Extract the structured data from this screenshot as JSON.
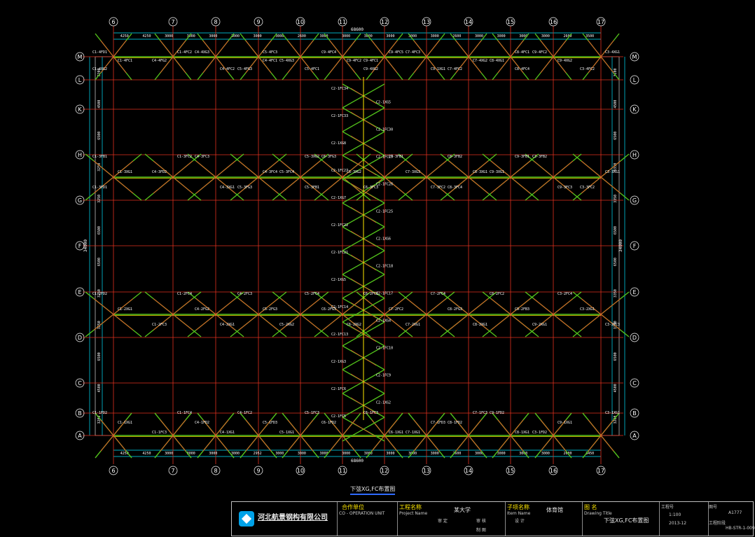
{
  "drawing": {
    "grid_cols": [
      "6",
      "7",
      "8",
      "9",
      "10",
      "11",
      "12",
      "13",
      "14",
      "15",
      "16",
      "17"
    ],
    "grid_rows": [
      "M",
      "L",
      "K",
      "H",
      "G",
      "F",
      "E",
      "D",
      "C",
      "B",
      "A"
    ],
    "overall_width": "68600",
    "overall_height": "34000",
    "top_spans": [
      "4250",
      "4250",
      "3000",
      "3000",
      "3000",
      "3000",
      "3000",
      "3000",
      "2600",
      "3000",
      "3000",
      "3000",
      "3000",
      "3000",
      "3000",
      "2600",
      "3000",
      "3000",
      "3000",
      "3000",
      "2600",
      "3500"
    ],
    "bottom_spans": [
      "4250",
      "4250",
      "3000",
      "3000",
      "3000",
      "3000",
      "2952",
      "3000",
      "3000",
      "3000",
      "3000",
      "3000",
      "3000",
      "3000",
      "3000",
      "2600",
      "3000",
      "3000",
      "3000",
      "3000",
      "2600",
      "3450"
    ],
    "left_spans": [
      "3200",
      "4500",
      "6500",
      "3250",
      "3250",
      "6500",
      "6500",
      "3250",
      "3250",
      "6500",
      "4500",
      "3200"
    ],
    "right_spans": [
      "3100",
      "4500",
      "6500",
      "3350",
      "3350",
      "6500",
      "6500",
      "3350",
      "3350",
      "6500",
      "4500",
      "3200"
    ],
    "brace_labels": {
      "row_M": [
        "C1-4FD1",
        "C1-4FC1",
        "C1-4XG2",
        "C1-4FC2",
        "C4-4FG2",
        "C4-4FC2",
        "C4-4XG3",
        "C4-4FC1",
        "C5-4FG3",
        "C5-4FC3",
        "C5-4XG3",
        "C5-4FC1",
        "C9-4FC4",
        "C9-4FC2",
        "C9-4XG2",
        "C9-4FC5",
        "C9-4FC1",
        "C9-1XG1",
        "C7-4FC3",
        "C7-4XG2",
        "C7-4FC2",
        "C8-4FC1",
        "C8-4XG1",
        "C8-4FC4",
        "C9-4FC2",
        "C9-4XG2",
        "C3-4FC2",
        "C3-4XG1"
      ],
      "row_H": [
        "C1-3FB1",
        "C1-3XG1",
        "C1-3FD1",
        "C1-3FC2",
        "C4-3FD2",
        "C4-3XG1",
        "C4-3FC3",
        "C4-3FC4",
        "C5-3FG3",
        "C5-3XG2",
        "C5-3FC4",
        "C5-3FB1",
        "C6-3FG3",
        "C6-3XG2",
        "C6-3FC3",
        "C7-3FB1",
        "C7-3XG3",
        "C7-3FC2",
        "C8-3FB2",
        "C8-3XG1",
        "C8-3FC4",
        "C9-3FB1",
        "C9-3XG1",
        "C9-3FC3",
        "C3-3FB2",
        "C3-3XG1",
        "C3-3FC2"
      ],
      "row_E": [
        "C1-2FD2",
        "C1-2XG1",
        "C1-2FC3",
        "C1-2FC4",
        "C4-2FG2",
        "C4-2XG1",
        "C4-2FC3",
        "C5-2FG3",
        "C5-2XG2",
        "C5-2FC4",
        "C6-2FG3",
        "C6-2XG2",
        "C6-2FC3",
        "C7-2FC2",
        "C7-2XG1",
        "C7-2FC4",
        "C8-2FG3",
        "C8-2XG1",
        "C8-2FC2",
        "C9-2FB3",
        "C9-2XG1",
        "C3-2FC4",
        "C3-2XG1",
        "C3-2FC3"
      ],
      "row_B": [
        "C1-1FD2",
        "C1-1XG1",
        "C1-1FC3",
        "C1-1FC4",
        "C4-1FD2",
        "C4-1XG1",
        "C4-1FC2",
        "C5-1FD3",
        "C5-1XG1",
        "C5-1FC3",
        "C6-1FD2",
        "C6-1XG1",
        "C6-1FC3",
        "C7-1FD3",
        "C7-1XG1",
        "C7-1FC3",
        "C8-1FD2",
        "C8-1XG1",
        "C9-1FD2",
        "C9-1XG1",
        "C3-1FD2",
        "C3-1XG1"
      ],
      "center_column": [
        "C2-1FC34",
        "C2-1XG5",
        "C2-1FC33",
        "C2-1FC30",
        "C2-1XG8",
        "C2-1FC29",
        "C2-1FC27",
        "C2-1FC26",
        "C2-1XG7",
        "C2-1FC25",
        "C2-1FC22",
        "C2-1XG6",
        "C2-1FC21",
        "C2-1FC18",
        "C2-1XG5",
        "C2-1FC17",
        "C2-1FC14",
        "C2-1XG4",
        "C2-1FC13",
        "C2-1FC10",
        "C2-1XG3",
        "C2-1FC9",
        "C2-1FC6",
        "C2-1XG2",
        "C2-1FC5"
      ]
    }
  },
  "plan_title": "下弦XG,FC布置图",
  "title_block": {
    "company": "河北航景钢构有限公司",
    "client_label": "合作单位",
    "client_sub": "CO - OPERATION UNIT",
    "project_label": "工程名称",
    "project_sub": "Project Name",
    "project_value": "某大学",
    "subproject_label": "子项名称",
    "subproject_sub": "Item Name",
    "subproject_value": "体育馆",
    "drawing_label": "图 名",
    "drawing_sub": "Drawing Title",
    "drawing_value": "下弦XG,FC布置图",
    "approved_label": "审 定",
    "checked_label": "审 核",
    "designer_label": "设 计",
    "drawn_label": "制 图",
    "number_label": "工程号",
    "scale_value": "1:100",
    "date_value": "2013-12",
    "sheet_label": "图号",
    "sheet_value": "A1777",
    "code_value": "HB-STR-1-009",
    "stage_label": "工程阶段"
  },
  "colors": {
    "background": "#000000",
    "grid_line": "#e0301e",
    "dimension": "#00e5ff",
    "member_green": "#52c11b",
    "member_yellow": "#ffe800",
    "member_red": "#ff3b2f",
    "label_text": "#ffffff",
    "logo": "#00a2e8"
  },
  "icons": {
    "logo": "company-logo-icon"
  }
}
